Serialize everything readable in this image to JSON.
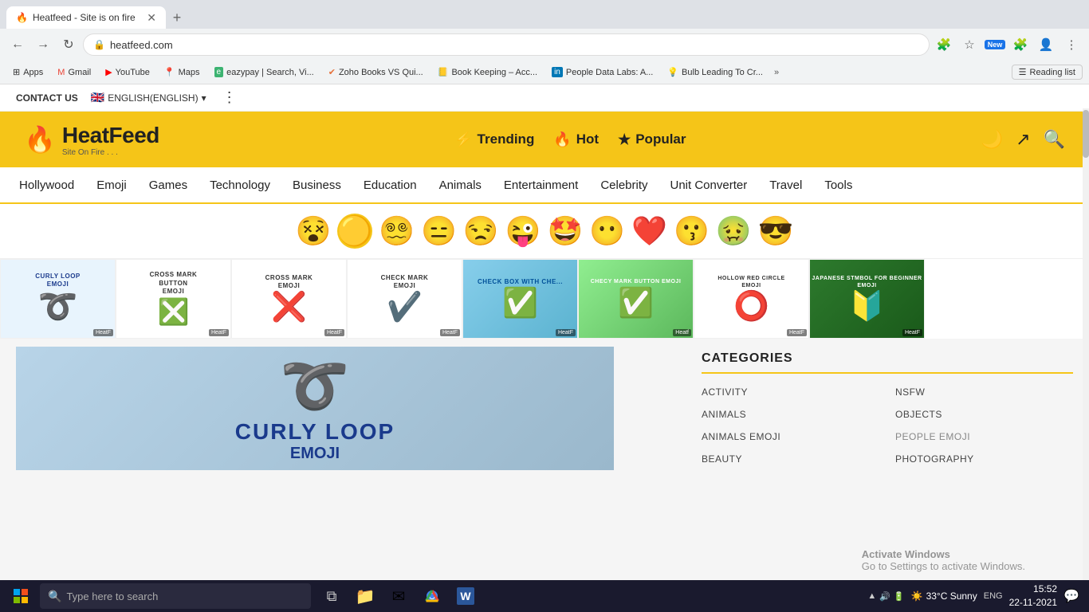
{
  "browser": {
    "tab": {
      "title": "Heatfeed - Site is on fire",
      "favicon": "🔥"
    },
    "address": "heatfeed.com",
    "bookmarks": [
      {
        "label": "Apps",
        "icon": "⊞"
      },
      {
        "label": "Gmail",
        "icon": "✉"
      },
      {
        "label": "YouTube",
        "icon": "▶"
      },
      {
        "label": "Maps",
        "icon": "🗺"
      },
      {
        "label": "eazypay | Search, Vi...",
        "icon": "🔵"
      },
      {
        "label": "Zoho Books VS Qui...",
        "icon": "✔"
      },
      {
        "label": "Book Keeping – Acc...",
        "icon": "🟡"
      },
      {
        "label": "People Data Labs: A...",
        "icon": "🔵"
      },
      {
        "label": "Bulb Leading To Cr...",
        "icon": "💡"
      }
    ],
    "reading_list": "Reading list"
  },
  "topbar": {
    "contact": "CONTACT US",
    "language": "ENGLISH(ENGLISH)",
    "flag": "🇬🇧"
  },
  "header": {
    "logo_name": "HeatFeed",
    "logo_tagline": "Site On Fire . . .",
    "nav": [
      {
        "icon": "⚡",
        "label": "Trending"
      },
      {
        "icon": "🔥",
        "label": "Hot"
      },
      {
        "icon": "★",
        "label": "Popular"
      }
    ]
  },
  "main_nav": [
    "Hollywood",
    "Emoji",
    "Games",
    "Technology",
    "Business",
    "Education",
    "Animals",
    "Entertainment",
    "Celebrity",
    "Unit Converter",
    "Travel",
    "Tools"
  ],
  "emojis": [
    "😵",
    "🟡",
    "😵‍💫",
    "😑",
    "😒",
    "😜",
    "🤩",
    "😶",
    "❤️",
    "😗",
    "🤢",
    "😎"
  ],
  "articles": [
    {
      "title": "Curly Loop Emoji",
      "bg": "#e8f4fd",
      "symbol": "➰",
      "color": "#1a3a8c"
    },
    {
      "title": "Cross Mark Button Emoji",
      "bg": "#fff",
      "symbol": "❎",
      "color": "#cc0000"
    },
    {
      "title": "Cross Mark Emoji",
      "bg": "#fff",
      "symbol": "❌",
      "color": "#cc0000"
    },
    {
      "title": "Check Mark Emoji",
      "bg": "#fff",
      "symbol": "✔️",
      "color": "#2a7a2a"
    },
    {
      "title": "Check Box with Che...",
      "bg": "#87ceeb",
      "symbol": "✅",
      "color": "#005099"
    },
    {
      "title": "Checy Mark Button Emoji",
      "bg": "#90ee90",
      "symbol": "✅",
      "color": "#2a7a2a"
    },
    {
      "title": "Hollow Red Circle Emoji",
      "bg": "#fff",
      "symbol": "⭕",
      "color": "#cc0000"
    },
    {
      "title": "Japanese Symbol For Beginner Emoji",
      "bg": "#2d7a2d",
      "symbol": "🔰",
      "color": "#fff"
    }
  ],
  "main_article": {
    "image_alt": "Curly Loop Emoji",
    "symbol": "➰",
    "title_line1": "CURLY LOOP",
    "title_line2": "EMOJI"
  },
  "categories": {
    "heading": "CATEGORIES",
    "items": [
      [
        "ACTIVITY",
        "NSFW"
      ],
      [
        "ANIMALS",
        "OBJECTS"
      ],
      [
        "ANIMALS EMOJI",
        "PEOPLE EMOJI"
      ],
      [
        "BEAUTY",
        "PHOTOGRAPHY"
      ]
    ]
  },
  "taskbar": {
    "search_placeholder": "Type here to search",
    "weather": "33°C Sunny",
    "language": "ENG",
    "time": "15:52",
    "date": "22-11-2021",
    "apps": [
      {
        "name": "task-view",
        "icon": "⧉"
      },
      {
        "name": "file-explorer",
        "icon": "📁"
      },
      {
        "name": "mail",
        "icon": "✉"
      },
      {
        "name": "chrome",
        "icon": "◎"
      },
      {
        "name": "word",
        "icon": "W"
      }
    ]
  },
  "activate_windows": {
    "line1": "Activate Windows",
    "line2": "Go to Settings to activate Windows."
  }
}
